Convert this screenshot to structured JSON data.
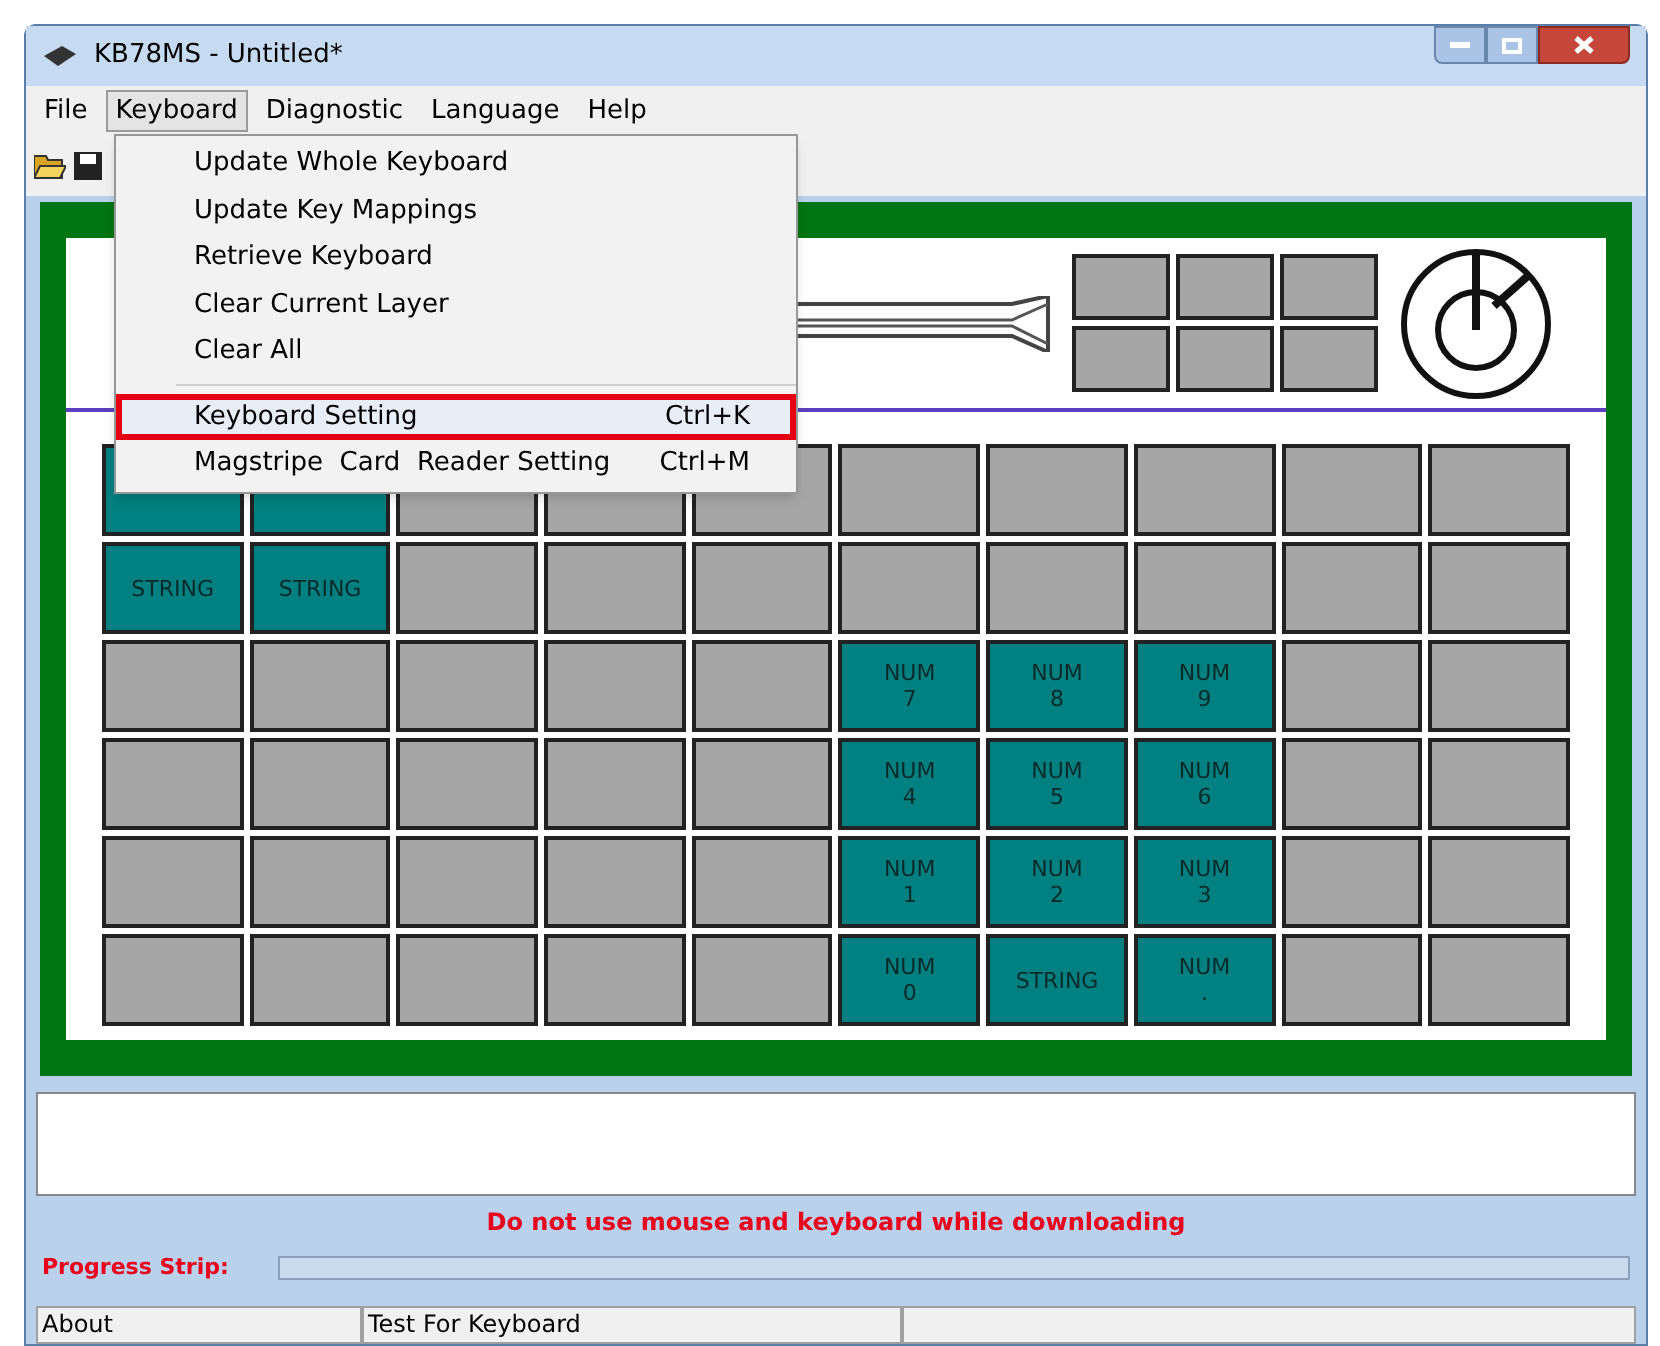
{
  "window": {
    "title": "KB78MS - Untitled*"
  },
  "menu_bar": [
    {
      "label": "File",
      "selected": false
    },
    {
      "label": "Keyboard",
      "selected": true
    },
    {
      "label": "Diagnostic",
      "selected": false
    },
    {
      "label": "Language",
      "selected": false
    },
    {
      "label": "Help",
      "selected": false
    }
  ],
  "dropdown": [
    {
      "kind": "item",
      "label": "Update Whole Keyboard",
      "selected": false
    },
    {
      "kind": "item",
      "label": "Update Key Mappings",
      "selected": false
    },
    {
      "kind": "item",
      "label": "Retrieve Keyboard",
      "selected": false
    },
    {
      "kind": "item",
      "label": "Clear Current Layer",
      "selected": false
    },
    {
      "kind": "item",
      "label": "Clear All",
      "selected": false
    },
    {
      "kind": "separator"
    },
    {
      "kind": "item",
      "label": "Keyboard Setting",
      "shortcut": "Ctrl+K",
      "selected": true
    },
    {
      "kind": "item",
      "label": "Magstripe  Card  Reader Setting",
      "shortcut": "Ctrl+M",
      "selected": false
    }
  ],
  "keys": [
    [
      {
        "kind": "assigned"
      },
      {
        "kind": "assigned"
      },
      {
        "kind": "empty"
      },
      {
        "kind": "empty"
      },
      {
        "kind": "empty"
      },
      {
        "kind": "empty"
      },
      {
        "kind": "empty"
      },
      {
        "kind": "empty"
      },
      {
        "kind": "empty"
      },
      {
        "kind": "empty"
      }
    ],
    [
      {
        "kind": "assigned",
        "lines": [
          "STRING"
        ]
      },
      {
        "kind": "assigned",
        "lines": [
          "STRING"
        ]
      },
      {
        "kind": "empty"
      },
      {
        "kind": "empty"
      },
      {
        "kind": "empty"
      },
      {
        "kind": "empty"
      },
      {
        "kind": "empty"
      },
      {
        "kind": "empty"
      },
      {
        "kind": "empty"
      },
      {
        "kind": "empty"
      }
    ],
    [
      {
        "kind": "empty"
      },
      {
        "kind": "empty"
      },
      {
        "kind": "empty"
      },
      {
        "kind": "empty"
      },
      {
        "kind": "empty"
      },
      {
        "kind": "assigned",
        "lines": [
          "NUM",
          "7"
        ]
      },
      {
        "kind": "assigned",
        "lines": [
          "NUM",
          "8"
        ]
      },
      {
        "kind": "assigned",
        "lines": [
          "NUM",
          "9"
        ]
      },
      {
        "kind": "empty"
      },
      {
        "kind": "empty"
      }
    ],
    [
      {
        "kind": "empty"
      },
      {
        "kind": "empty"
      },
      {
        "kind": "empty"
      },
      {
        "kind": "empty"
      },
      {
        "kind": "empty"
      },
      {
        "kind": "assigned",
        "lines": [
          "NUM",
          "4"
        ]
      },
      {
        "kind": "assigned",
        "lines": [
          "NUM",
          "5"
        ]
      },
      {
        "kind": "assigned",
        "lines": [
          "NUM",
          "6"
        ]
      },
      {
        "kind": "empty"
      },
      {
        "kind": "empty"
      }
    ],
    [
      {
        "kind": "empty"
      },
      {
        "kind": "empty"
      },
      {
        "kind": "empty"
      },
      {
        "kind": "empty"
      },
      {
        "kind": "empty"
      },
      {
        "kind": "assigned",
        "lines": [
          "NUM",
          "1"
        ]
      },
      {
        "kind": "assigned",
        "lines": [
          "NUM",
          "2"
        ]
      },
      {
        "kind": "assigned",
        "lines": [
          "NUM",
          "3"
        ]
      },
      {
        "kind": "empty"
      },
      {
        "kind": "empty"
      }
    ],
    [
      {
        "kind": "empty"
      },
      {
        "kind": "empty"
      },
      {
        "kind": "empty"
      },
      {
        "kind": "empty"
      },
      {
        "kind": "empty"
      },
      {
        "kind": "assigned",
        "lines": [
          "NUM",
          "0"
        ]
      },
      {
        "kind": "assigned",
        "lines": [
          "STRING"
        ]
      },
      {
        "kind": "assigned",
        "lines": [
          "NUM",
          "."
        ]
      },
      {
        "kind": "empty"
      },
      {
        "kind": "empty"
      }
    ]
  ],
  "warning": "Do not use mouse and keyboard while downloading",
  "progress": {
    "label": "Progress Strip:"
  },
  "status_bar": [
    "About",
    "Test For Keyboard"
  ]
}
